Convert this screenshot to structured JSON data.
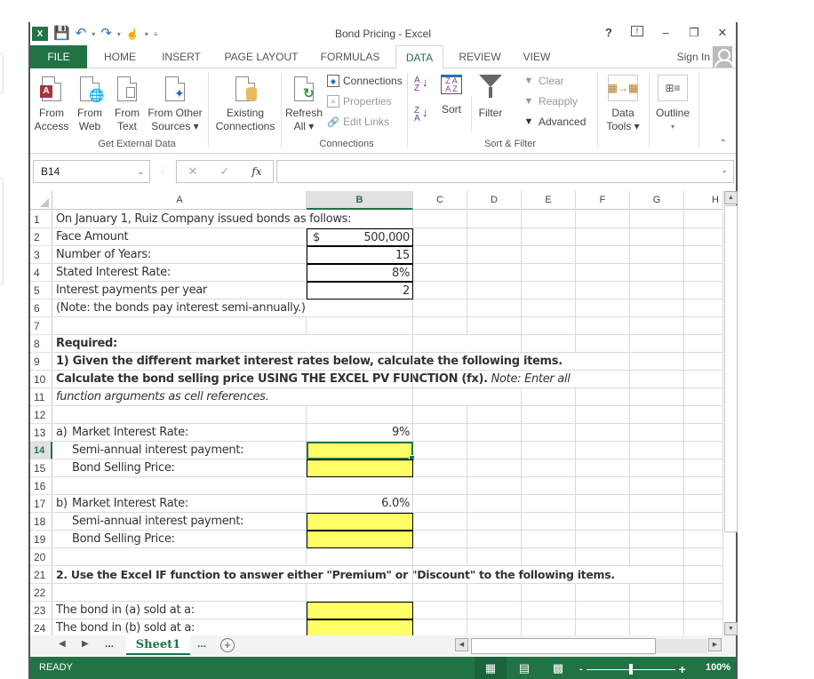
{
  "window": {
    "title": "Bond Pricing - Excel",
    "controls": [
      "?",
      "ribbon-display",
      "minimize",
      "restore",
      "close"
    ]
  },
  "quick_access": [
    "save",
    "undo",
    "redo",
    "touch-mode",
    "customize"
  ],
  "tabs": [
    "FILE",
    "HOME",
    "INSERT",
    "PAGE LAYOUT",
    "FORMULAS",
    "DATA",
    "REVIEW",
    "VIEW"
  ],
  "active_tab": "DATA",
  "sign_in": "Sign In",
  "ribbon": {
    "get_external_data": {
      "label": "Get External Data",
      "buttons": [
        {
          "line1": "From",
          "line2": "Access"
        },
        {
          "line1": "From",
          "line2": "Web"
        },
        {
          "line1": "From",
          "line2": "Text"
        },
        {
          "line1": "From Other",
          "line2": "Sources ▾"
        }
      ]
    },
    "existing": {
      "line1": "Existing",
      "line2": "Connections"
    },
    "connections": {
      "label": "Connections",
      "refresh": {
        "line1": "Refresh",
        "line2": "All ▾"
      },
      "items": [
        "Connections",
        "Properties",
        "Edit Links"
      ]
    },
    "sort_filter": {
      "label": "Sort & Filter",
      "sort": "Sort",
      "filter": "Filter",
      "items": [
        "Clear",
        "Reapply",
        "Advanced"
      ]
    },
    "data_tools": {
      "line1": "Data",
      "line2": "Tools ▾"
    },
    "outline": {
      "line1": "Outline",
      "line2": "▾"
    }
  },
  "formula_bar": {
    "name_box": "B14",
    "formula": ""
  },
  "columns": [
    "A",
    "B",
    "C",
    "D",
    "E",
    "F",
    "G",
    "H"
  ],
  "selected_column": "B",
  "selected_row": "14",
  "rows": [
    {
      "n": "1",
      "a": "On January 1,  Ruiz Company issued bonds as follows:",
      "b": ""
    },
    {
      "n": "2",
      "a": "Face Amount",
      "b_prefix": "$",
      "b": "500,000"
    },
    {
      "n": "3",
      "a": "Number of Years:",
      "b": "15"
    },
    {
      "n": "4",
      "a": "Stated Interest Rate:",
      "b": "8%"
    },
    {
      "n": "5",
      "a": "Interest payments per year",
      "b": "2"
    },
    {
      "n": "6",
      "a": "(Note: the bonds pay interest semi-annually.)",
      "b": ""
    },
    {
      "n": "7",
      "a": "",
      "b": ""
    },
    {
      "n": "8",
      "a": "Required:",
      "b": ""
    },
    {
      "n": "9",
      "a": " 1) Given the different market interest rates below, calculate the following items.",
      "b": ""
    },
    {
      "n": "10",
      "a": "Calculate the bond selling price USING THE EXCEL PV FUNCTION (fx).",
      "a_note": " Note: Enter all",
      "b": ""
    },
    {
      "n": "11",
      "a": "function arguments as cell references.",
      "b": ""
    },
    {
      "n": "12",
      "a": "",
      "b": ""
    },
    {
      "n": "13",
      "a_prefix": "a)",
      "a": "Market Interest Rate:",
      "b": "9%"
    },
    {
      "n": "14",
      "a": "Semi-annual interest payment:",
      "b": ""
    },
    {
      "n": "15",
      "a": "Bond Selling Price:",
      "b": ""
    },
    {
      "n": "16",
      "a": "",
      "b": ""
    },
    {
      "n": "17",
      "a_prefix": "b)",
      "a": "Market Interest Rate:",
      "b": "6.0%"
    },
    {
      "n": "18",
      "a": "Semi-annual interest payment:",
      "b": ""
    },
    {
      "n": "19",
      "a": "Bond Selling Price:",
      "b": ""
    },
    {
      "n": "20",
      "a": "",
      "b": ""
    },
    {
      "n": "21",
      "a": "2. Use the Excel IF function to answer either \"Premium\" or \"Discount\" to the following items.",
      "b": ""
    },
    {
      "n": "22",
      "a": "",
      "b": ""
    },
    {
      "n": "23",
      "a": "The bond in (a) sold at a:",
      "b": ""
    },
    {
      "n": "24",
      "a": "The bond in (b) sold at a:",
      "b": ""
    }
  ],
  "sheets": [
    "Sheet1"
  ],
  "sheet_nav": {
    "ellipsis": "..."
  },
  "status": {
    "mode": "READY",
    "zoom": "100%",
    "zoom_minus": "-",
    "zoom_plus": "+"
  }
}
